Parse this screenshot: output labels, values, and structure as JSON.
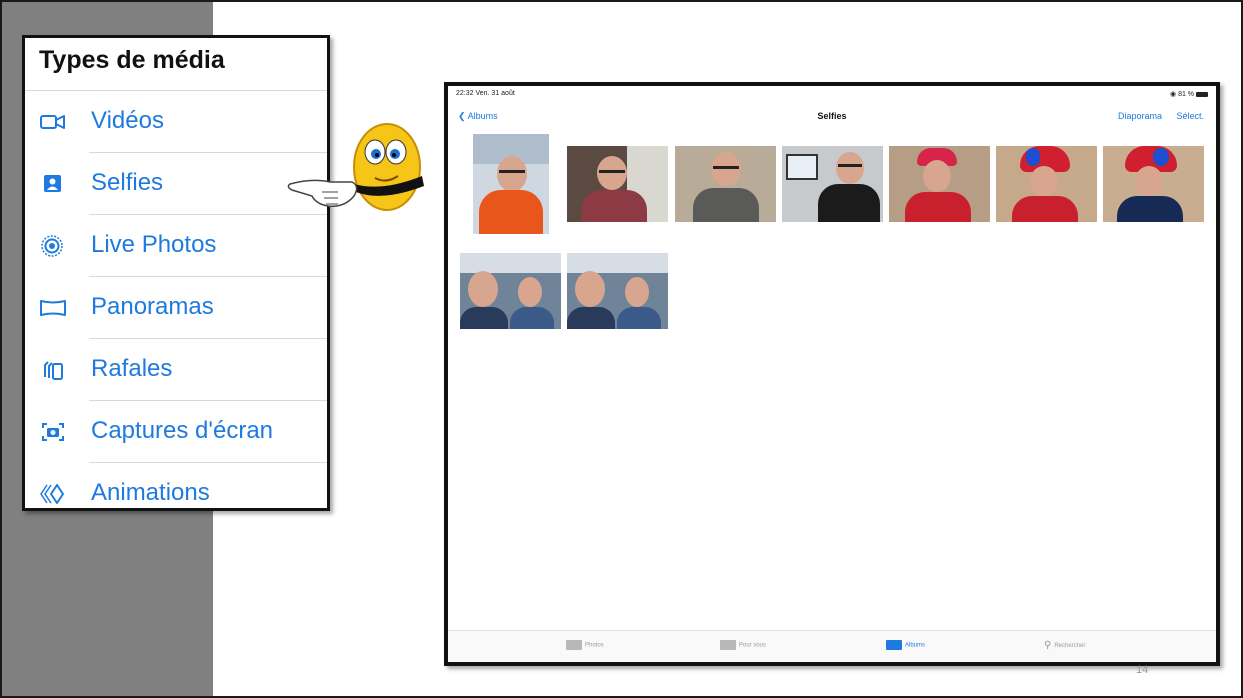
{
  "media_panel": {
    "title": "Types de média",
    "items": [
      {
        "label": "Vidéos",
        "icon": "video-icon"
      },
      {
        "label": "Selfies",
        "icon": "selfie-icon"
      },
      {
        "label": "Live Photos",
        "icon": "live-photo-icon"
      },
      {
        "label": "Panoramas",
        "icon": "panorama-icon"
      },
      {
        "label": "Rafales",
        "icon": "burst-icon"
      },
      {
        "label": "Captures d'écran",
        "icon": "screenshot-icon"
      },
      {
        "label": "Animations",
        "icon": "animation-icon"
      }
    ],
    "accent_color": "#1f7ae0"
  },
  "ipad": {
    "status": {
      "time": "22:32  Ven. 31 août",
      "right": "81 %"
    },
    "nav": {
      "back_label": "Albums",
      "title": "Selfies",
      "slideshow_label": "Diaporama",
      "select_label": "Sélect."
    },
    "photo_count": 9,
    "tabs": [
      {
        "label": "Photos",
        "icon": "photos-tab-icon",
        "active": false
      },
      {
        "label": "Pour vous",
        "icon": "for-you-tab-icon",
        "active": false
      },
      {
        "label": "Albums",
        "icon": "albums-tab-icon",
        "active": true
      },
      {
        "label": "Rechercher",
        "icon": "search-tab-icon",
        "active": false
      }
    ]
  },
  "page_number": "14",
  "colors": {
    "side_band": "#808080",
    "ios_blue": "#1f7ae0"
  }
}
